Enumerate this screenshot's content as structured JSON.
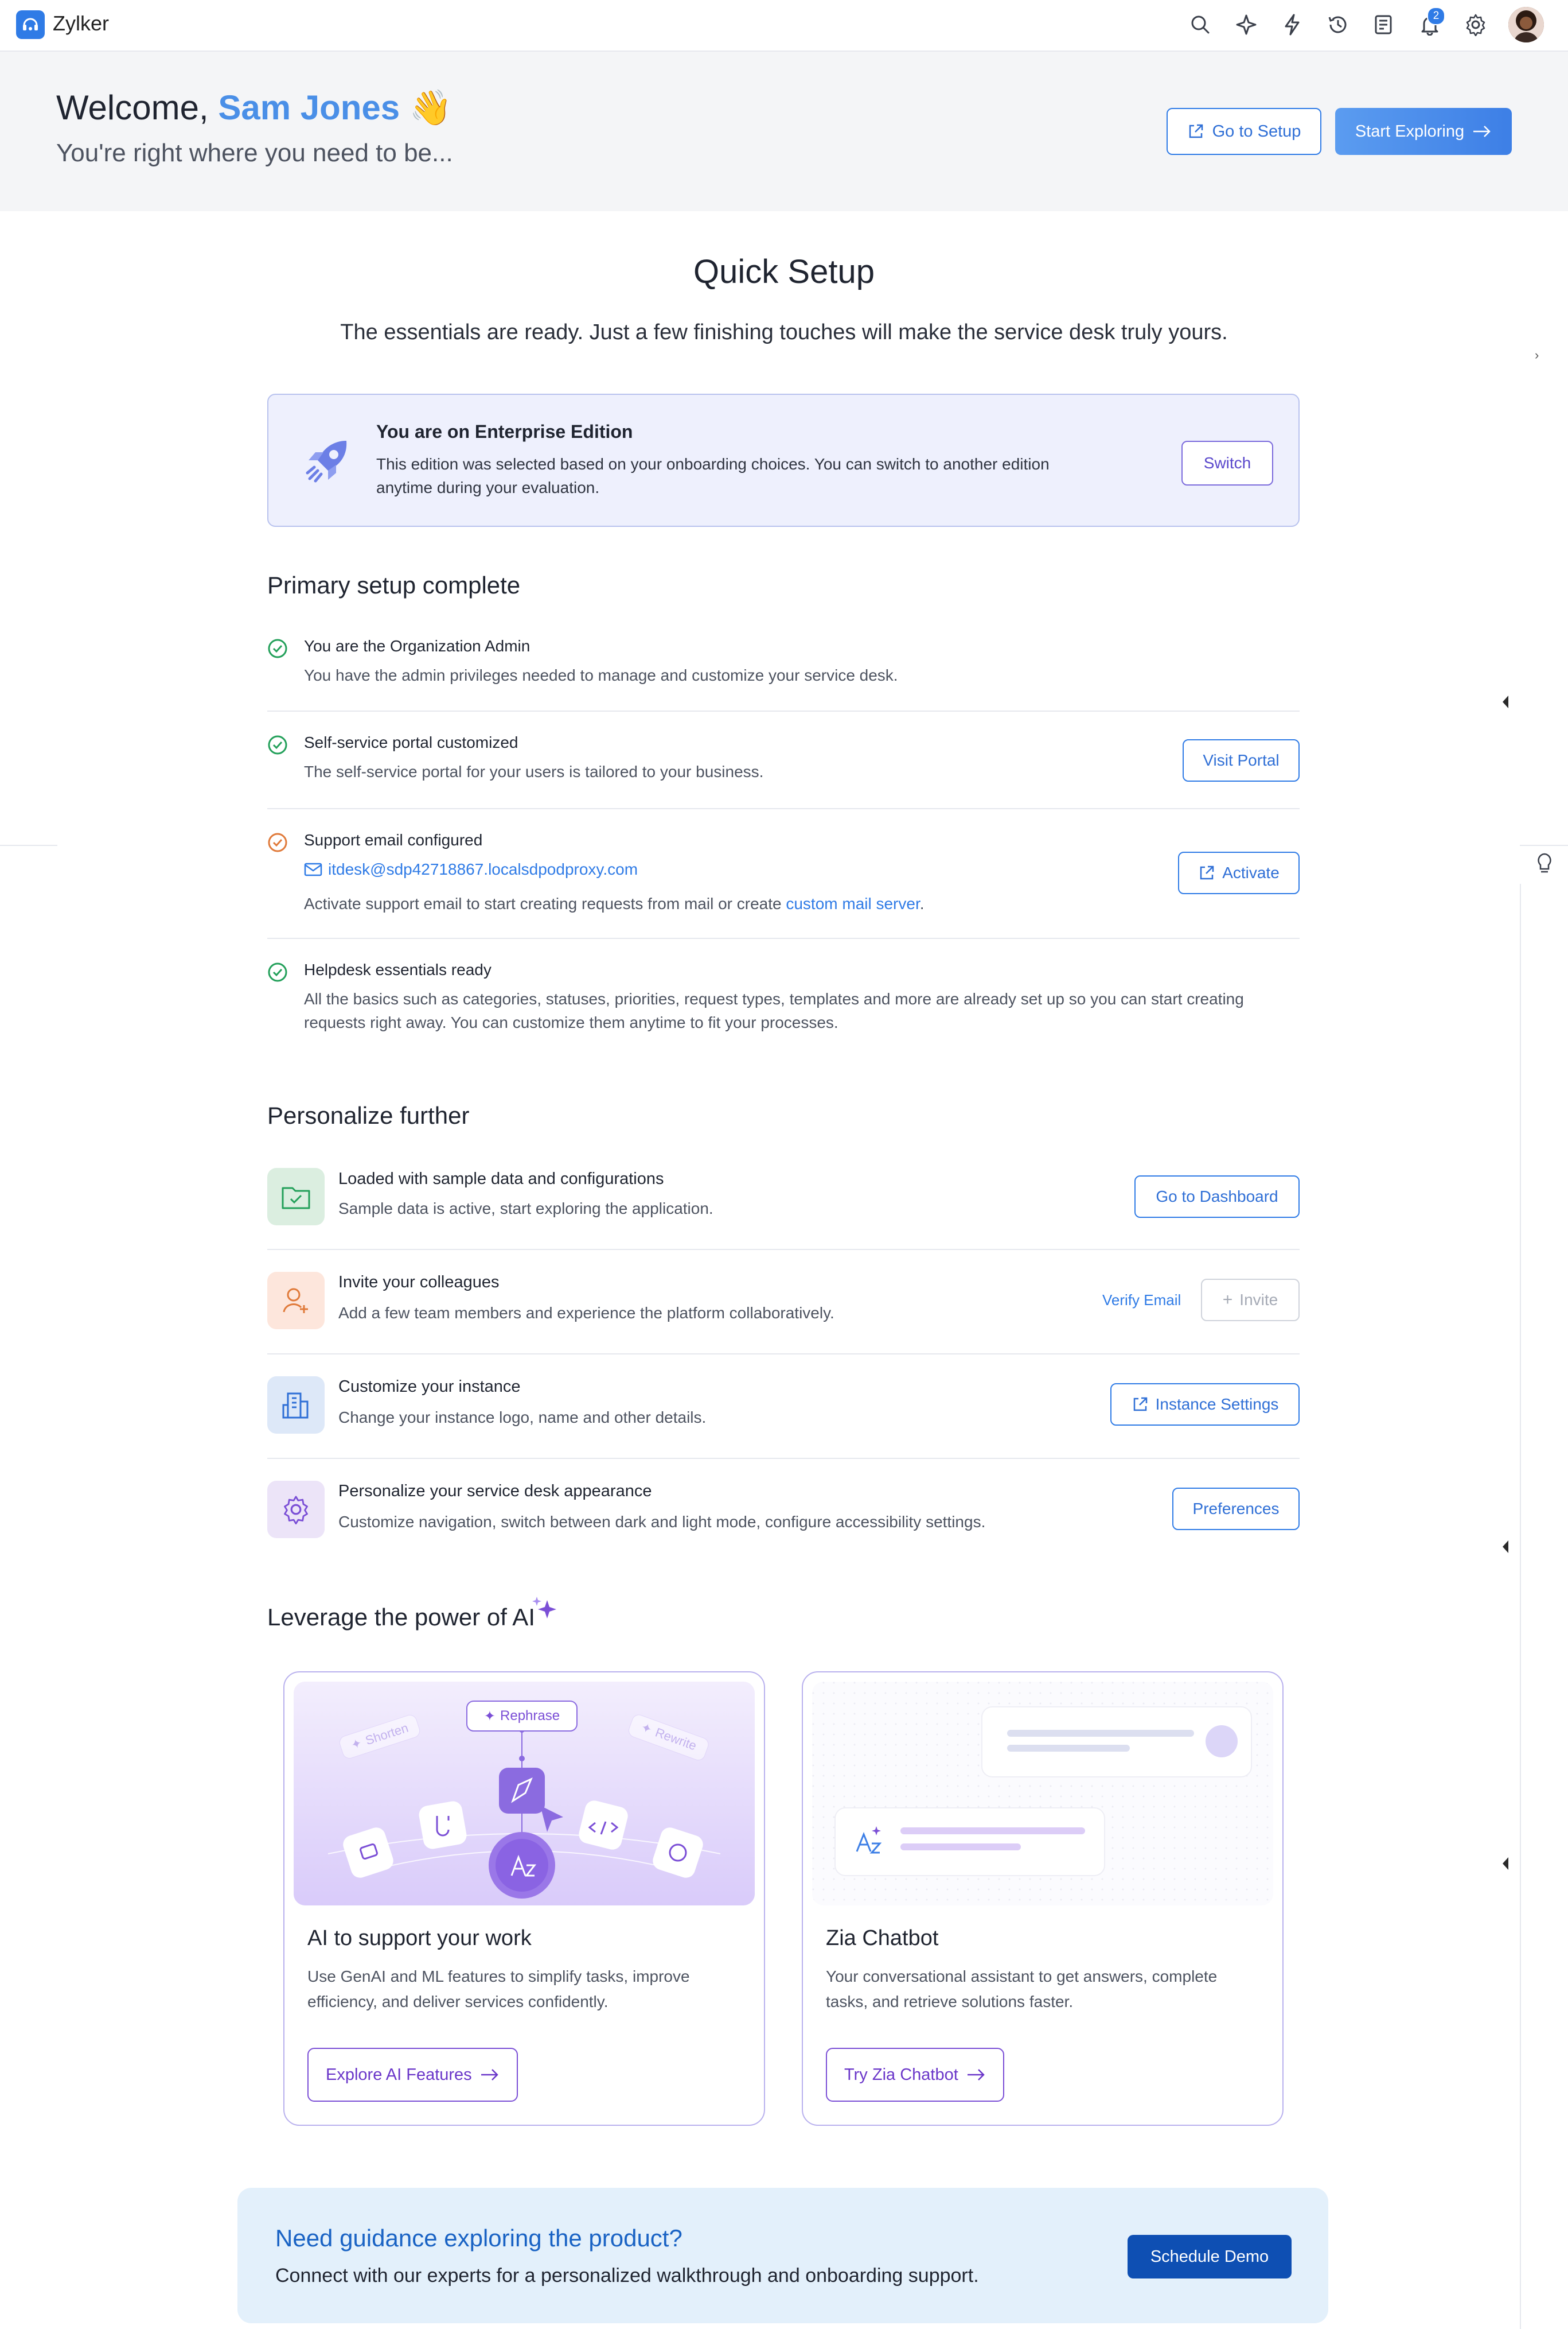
{
  "app": {
    "name": "Zylker",
    "notification_count": "2"
  },
  "welcome": {
    "greeting": "Welcome,",
    "user_name": "Sam Jones",
    "emoji": "👋",
    "subtitle": "You're right where you need to be...",
    "go_to_setup": "Go to Setup",
    "start_exploring": "Start Exploring"
  },
  "quick_setup": {
    "title": "Quick Setup",
    "subtitle": "The essentials are ready. Just a few finishing touches will make the service desk truly yours."
  },
  "edition": {
    "title": "You are on Enterprise Edition",
    "description": "This edition was selected based on your onboarding choices. You can switch to another edition anytime during your evaluation.",
    "switch_label": "Switch"
  },
  "primary": {
    "heading": "Primary setup complete",
    "items": [
      {
        "title": "You are the Organization Admin",
        "description": "You have the admin privileges needed to manage and customize your service desk."
      },
      {
        "title": "Self-service portal customized",
        "description": "The self-service portal for your users is tailored to your business.",
        "action": "Visit Portal"
      },
      {
        "title": "Support email configured",
        "email": "itdesk@sdp42718867.localsdpodproxy.com",
        "description_prefix": "Activate support email to start creating requests from mail or create ",
        "description_link": "custom mail server",
        "description_suffix": ".",
        "action": "Activate"
      },
      {
        "title": "Helpdesk essentials ready",
        "description": "All the basics such as categories, statuses, priorities, request types, templates and more are already set up so you can start creating requests right away. You can customize them anytime to fit your processes."
      }
    ]
  },
  "personalize": {
    "heading": "Personalize further",
    "items": [
      {
        "title": "Loaded with sample data and configurations",
        "description": "Sample data is active, start exploring the application.",
        "action": "Go to Dashboard"
      },
      {
        "title": "Invite your colleagues",
        "description": "Add a few team members and experience the platform collaboratively.",
        "secondary_action": "Verify Email",
        "action": "Invite"
      },
      {
        "title": "Customize your instance",
        "description": "Change your instance logo, name and other details.",
        "action": "Instance Settings"
      },
      {
        "title": "Personalize your service desk appearance",
        "description": "Customize navigation, switch between dark and light mode, configure accessibility settings.",
        "action": "Preferences"
      }
    ]
  },
  "ai": {
    "heading": "Leverage the power of AI",
    "cards": [
      {
        "title": "AI to support your work",
        "description": "Use GenAI and ML features to simplify tasks, improve efficiency, and deliver services confidently.",
        "action": "Explore AI Features",
        "art_labels": {
          "rephrase": "Rephrase",
          "shorten": "Shorten",
          "rewrite": "Rewrite"
        }
      },
      {
        "title": "Zia Chatbot",
        "description": "Your conversational assistant to get answers, complete tasks, and retrieve solutions faster.",
        "action": "Try Zia Chatbot"
      }
    ]
  },
  "guidance": {
    "title": "Need guidance exploring the product?",
    "description": "Connect with our experts for a personalized walkthrough and onboarding support.",
    "action": "Schedule Demo"
  },
  "colors": {
    "primary": "#2f7be6",
    "success": "#23a05a",
    "warning": "#e07a3a",
    "ai_purple": "#7b4fd6",
    "guide_bg": "#e3f0fb"
  }
}
